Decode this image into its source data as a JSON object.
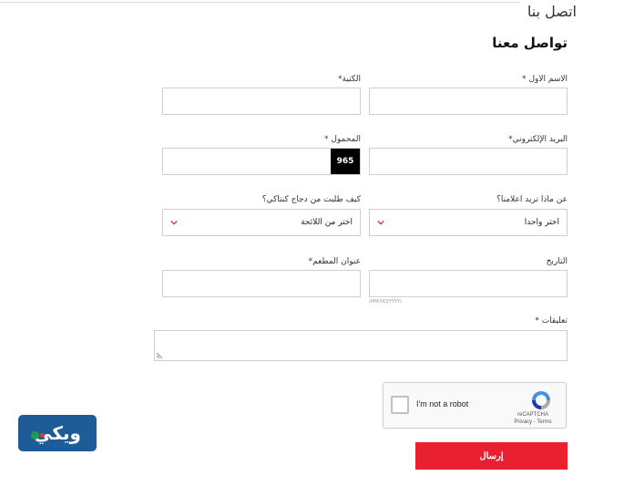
{
  "page": {
    "heading": "اتصل بنا",
    "section_title": "تواصل معنا"
  },
  "form": {
    "first_name_label": "الاسم الاول *",
    "last_name_label": "الكنية*",
    "email_label": "البريد الإلكتروني*",
    "mobile_label": "المحمول *",
    "mobile_code": "965",
    "topic_label": "عن ماذا تريد اعلامنا؟",
    "topic_value": "اختر واحدا",
    "source_label": "كيف طلبت من دجاج كنتاكي؟",
    "source_value": "اختر من اللائحة",
    "date_label": "التاريخ",
    "date_hint": "(MM/DD/YYYY)",
    "restaurant_label": "عنوان المطعم*",
    "comments_label": "تعليقات *"
  },
  "captcha": {
    "checkbox_label": "I'm not a robot",
    "brand": "reCAPTCHA",
    "links": "Privacy - Terms"
  },
  "actions": {
    "submit_label": "إرسال"
  },
  "watermark": {
    "logo_text": "ويكي"
  },
  "colors": {
    "submit": "#e8202f",
    "mobile_code_bg": "#000000",
    "chevron": "#e8202f",
    "logo_bg": "#1d5c97"
  },
  "icons": {
    "dropdown": "chevron-down-icon",
    "captcha_logo": "recaptcha-icon"
  }
}
